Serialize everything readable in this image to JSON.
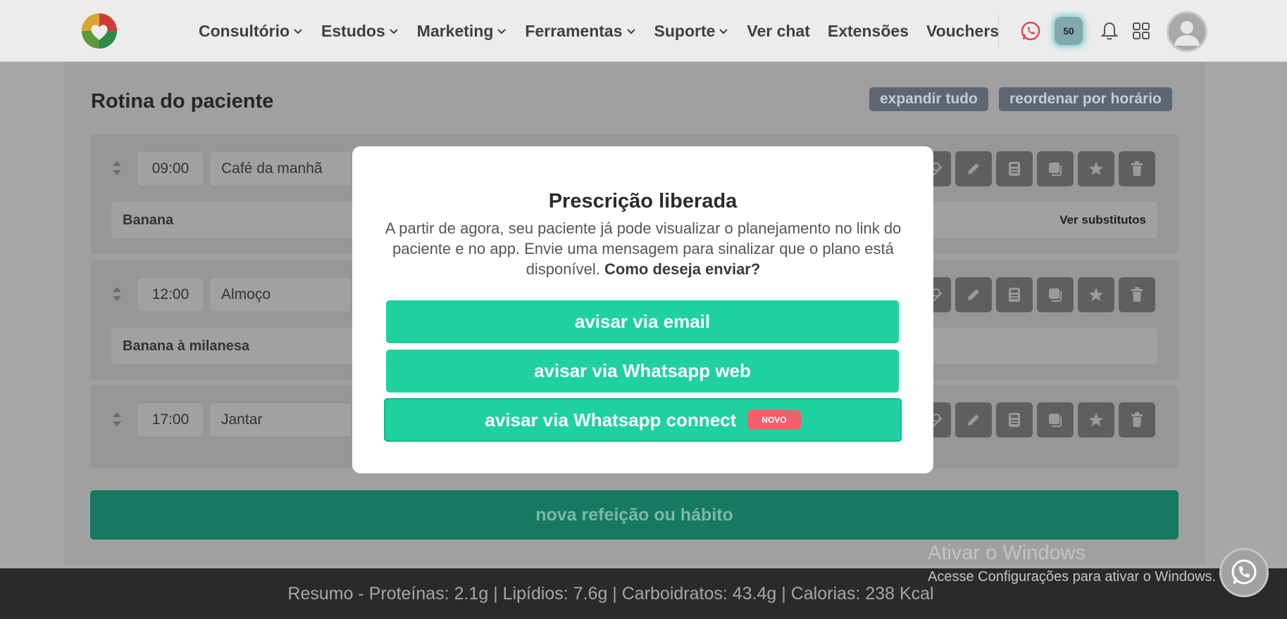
{
  "nav": {
    "items": [
      {
        "label": "Consultório",
        "dropdown": true
      },
      {
        "label": "Estudos",
        "dropdown": true
      },
      {
        "label": "Marketing",
        "dropdown": true
      },
      {
        "label": "Ferramentas",
        "dropdown": true
      },
      {
        "label": "Suporte",
        "dropdown": true
      },
      {
        "label": "Ver chat",
        "dropdown": false
      },
      {
        "label": "Extensões",
        "dropdown": false
      },
      {
        "label": "Vouchers",
        "dropdown": false
      }
    ],
    "badge_count": "50",
    "icons": [
      "whatsapp-icon",
      "badge-50",
      "bell-icon",
      "apps-grid-icon",
      "avatar"
    ]
  },
  "page": {
    "title": "Rotina do paciente",
    "expand_all": "expandir tudo",
    "reorder": "reordenar por horário"
  },
  "meals": [
    {
      "time": "09:00",
      "name": "Café da manhã",
      "food": "Banana",
      "substitutes": "Ver substitutos"
    },
    {
      "time": "12:00",
      "name": "Almoço",
      "food": "Banana à milanesa",
      "substitutes": ""
    },
    {
      "time": "17:00",
      "name": "Jantar",
      "food": "",
      "substitutes": ""
    }
  ],
  "meal_action_icons": [
    "no-image-icon",
    "pencil-icon",
    "calculator-icon",
    "copy-icon",
    "star-icon",
    "trash-icon"
  ],
  "new_meal_button": "nova refeição ou hábito",
  "footer": {
    "summary": "Resumo - Proteínas: 2.1g | Lipídios: 7.6g | Carboidratos: 43.4g | Calorias: 238 Kcal"
  },
  "watermark": {
    "title": "Ativar o Windows",
    "subtitle": "Acesse Configurações para ativar o Windows."
  },
  "modal": {
    "title": "Prescrição liberada",
    "text": "A partir de agora, seu paciente já pode visualizar o planejamento no link do paciente e no app. Envie uma mensagem para sinalizar que o plano está disponível.",
    "question": "Como deseja enviar?",
    "btn_email": "avisar via email",
    "btn_whatsapp_web": "avisar via Whatsapp web",
    "btn_whatsapp_connect": "avisar via Whatsapp connect",
    "new_badge": "NOVO"
  },
  "colors": {
    "accent_green": "#1fd19f",
    "dark_green": "#157a5f",
    "new_badge": "#f35f6b",
    "whatsapp_red": "#e0474c"
  }
}
